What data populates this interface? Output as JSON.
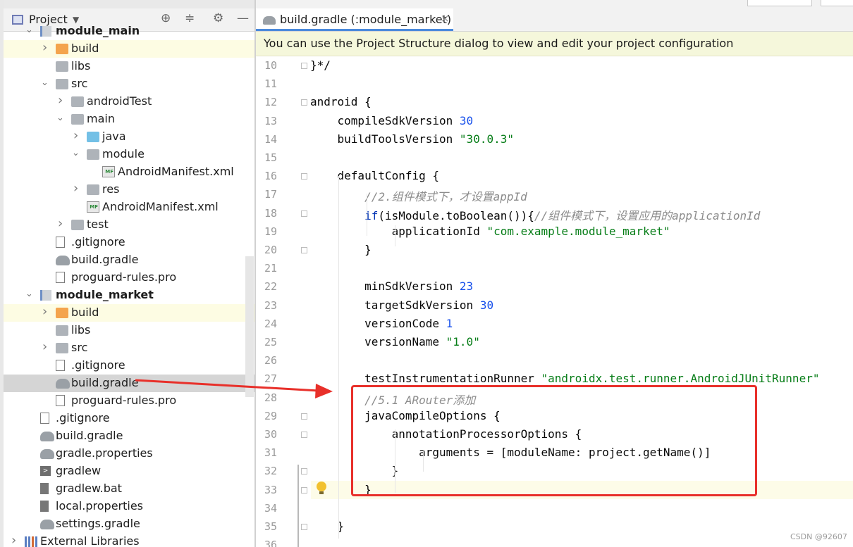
{
  "project_panel": {
    "title": "Project",
    "header_icons": [
      "target-icon",
      "collapse-icon",
      "gear-icon",
      "minimize-icon"
    ],
    "tree": [
      {
        "label": "module_main",
        "icon": "module-icon",
        "arrow": "down",
        "bold": true,
        "indent": 0
      },
      {
        "label": "build",
        "icon": "folder-orange-icon",
        "arrow": "right",
        "indent": 1,
        "highlight": true
      },
      {
        "label": "libs",
        "icon": "folder-icon",
        "arrow": "",
        "indent": 1
      },
      {
        "label": "src",
        "icon": "folder-icon",
        "arrow": "down",
        "indent": 1
      },
      {
        "label": "androidTest",
        "icon": "folder-icon",
        "arrow": "right",
        "indent": 2
      },
      {
        "label": "main",
        "icon": "folder-icon",
        "arrow": "down",
        "indent": 2
      },
      {
        "label": "java",
        "icon": "folder-blue-icon",
        "arrow": "right",
        "indent": 3
      },
      {
        "label": "module",
        "icon": "folder-icon",
        "arrow": "down",
        "indent": 3
      },
      {
        "label": "AndroidManifest.xml",
        "icon": "manifest-icon",
        "arrow": "",
        "indent": 4
      },
      {
        "label": "res",
        "icon": "res-folder-icon",
        "arrow": "right",
        "indent": 3
      },
      {
        "label": "AndroidManifest.xml",
        "icon": "manifest-icon",
        "arrow": "",
        "indent": 3
      },
      {
        "label": "test",
        "icon": "folder-icon",
        "arrow": "right",
        "indent": 2
      },
      {
        "label": ".gitignore",
        "icon": "gitignore-icon",
        "arrow": "",
        "indent": 1
      },
      {
        "label": "build.gradle",
        "icon": "gradle-icon",
        "arrow": "",
        "indent": 1
      },
      {
        "label": "proguard-rules.pro",
        "icon": "file-icon",
        "arrow": "",
        "indent": 1
      },
      {
        "label": "module_market",
        "icon": "module-icon",
        "arrow": "down",
        "bold": true,
        "indent": 0
      },
      {
        "label": "build",
        "icon": "folder-orange-icon",
        "arrow": "right",
        "indent": 1,
        "highlight": true
      },
      {
        "label": "libs",
        "icon": "folder-icon",
        "arrow": "",
        "indent": 1
      },
      {
        "label": "src",
        "icon": "folder-icon",
        "arrow": "right",
        "indent": 1
      },
      {
        "label": ".gitignore",
        "icon": "gitignore-icon",
        "arrow": "",
        "indent": 1
      },
      {
        "label": "build.gradle",
        "icon": "gradle-icon",
        "arrow": "",
        "indent": 1,
        "selected": true
      },
      {
        "label": "proguard-rules.pro",
        "icon": "file-icon",
        "arrow": "",
        "indent": 1
      },
      {
        "label": ".gitignore",
        "icon": "gitignore-icon",
        "arrow": "",
        "indent": 0
      },
      {
        "label": "build.gradle",
        "icon": "gradle-icon",
        "arrow": "",
        "indent": 0
      },
      {
        "label": "gradle.properties",
        "icon": "gradle-icon",
        "arrow": "",
        "indent": 0
      },
      {
        "label": "gradlew",
        "icon": "terminal-icon",
        "arrow": "",
        "indent": 0
      },
      {
        "label": "gradlew.bat",
        "icon": "bat-icon",
        "arrow": "",
        "indent": 0
      },
      {
        "label": "local.properties",
        "icon": "properties-icon",
        "arrow": "",
        "indent": 0
      },
      {
        "label": "settings.gradle",
        "icon": "gradle-icon",
        "arrow": "",
        "indent": 0
      },
      {
        "label": "External Libraries",
        "icon": "library-icon",
        "arrow": "right",
        "indent": -1
      }
    ]
  },
  "editor": {
    "tab": {
      "label": "build.gradle (:module_market)",
      "close": "×"
    },
    "banner": "You can use the Project Structure dialog to view and edit your project configuration",
    "lines": [
      {
        "n": "10",
        "t": [
          {
            "c": "",
            "s": "}*/"
          }
        ]
      },
      {
        "n": "11",
        "t": []
      },
      {
        "n": "12",
        "t": [
          {
            "c": "",
            "s": "android {"
          }
        ]
      },
      {
        "n": "13",
        "t": [
          {
            "c": "",
            "s": "    compileSdkVersion "
          },
          {
            "c": "num",
            "s": "30"
          }
        ]
      },
      {
        "n": "14",
        "t": [
          {
            "c": "",
            "s": "    buildToolsVersion "
          },
          {
            "c": "str",
            "s": "\"30.0.3\""
          }
        ]
      },
      {
        "n": "15",
        "t": []
      },
      {
        "n": "16",
        "t": [
          {
            "c": "",
            "s": "    defaultConfig {"
          }
        ]
      },
      {
        "n": "17",
        "t": [
          {
            "c": "cmt",
            "s": "        //2.组件模式下，才设置appId"
          }
        ]
      },
      {
        "n": "18",
        "t": [
          {
            "c": "kw",
            "s": "        if"
          },
          {
            "c": "",
            "s": "(isModule.toBoolean()){"
          },
          {
            "c": "cmt",
            "s": "//组件模式下，设置应用的applicationId"
          }
        ]
      },
      {
        "n": "19",
        "t": [
          {
            "c": "",
            "s": "            applicationId "
          },
          {
            "c": "str",
            "s": "\"com.example.module_market\""
          }
        ]
      },
      {
        "n": "20",
        "t": [
          {
            "c": "",
            "s": "        }"
          }
        ]
      },
      {
        "n": "21",
        "t": []
      },
      {
        "n": "22",
        "t": [
          {
            "c": "",
            "s": "        minSdkVersion "
          },
          {
            "c": "num",
            "s": "23"
          }
        ]
      },
      {
        "n": "23",
        "t": [
          {
            "c": "",
            "s": "        targetSdkVersion "
          },
          {
            "c": "num",
            "s": "30"
          }
        ]
      },
      {
        "n": "24",
        "t": [
          {
            "c": "",
            "s": "        versionCode "
          },
          {
            "c": "num",
            "s": "1"
          }
        ]
      },
      {
        "n": "25",
        "t": [
          {
            "c": "",
            "s": "        versionName "
          },
          {
            "c": "str",
            "s": "\"1.0\""
          }
        ]
      },
      {
        "n": "26",
        "t": []
      },
      {
        "n": "27",
        "t": [
          {
            "c": "",
            "s": "        testInstrumentationRunner "
          },
          {
            "c": "str",
            "s": "\"androidx.test.runner.AndroidJUnitRunner\""
          }
        ]
      },
      {
        "n": "28",
        "t": [
          {
            "c": "cmt",
            "s": "        //5.1 ARouter添加"
          }
        ]
      },
      {
        "n": "29",
        "t": [
          {
            "c": "",
            "s": "        javaCompileOptions "
          },
          {
            "c": "",
            "s": "{"
          }
        ]
      },
      {
        "n": "30",
        "t": [
          {
            "c": "",
            "s": "            annotationProcessorOptions {"
          }
        ]
      },
      {
        "n": "31",
        "t": [
          {
            "c": "",
            "s": "                arguments = [moduleName: project.getName()]"
          }
        ]
      },
      {
        "n": "32",
        "t": [
          {
            "c": "",
            "s": "            }"
          }
        ]
      },
      {
        "n": "33",
        "t": [
          {
            "c": "",
            "s": "        }"
          }
        ]
      },
      {
        "n": "34",
        "t": []
      },
      {
        "n": "35",
        "t": [
          {
            "c": "",
            "s": "    }"
          }
        ]
      },
      {
        "n": "36",
        "t": []
      }
    ]
  },
  "colors": {
    "annotation": "#e8302a",
    "banner": "#f5f7db",
    "selection": "#d5d5d5"
  },
  "watermark": "CSDN @92607"
}
